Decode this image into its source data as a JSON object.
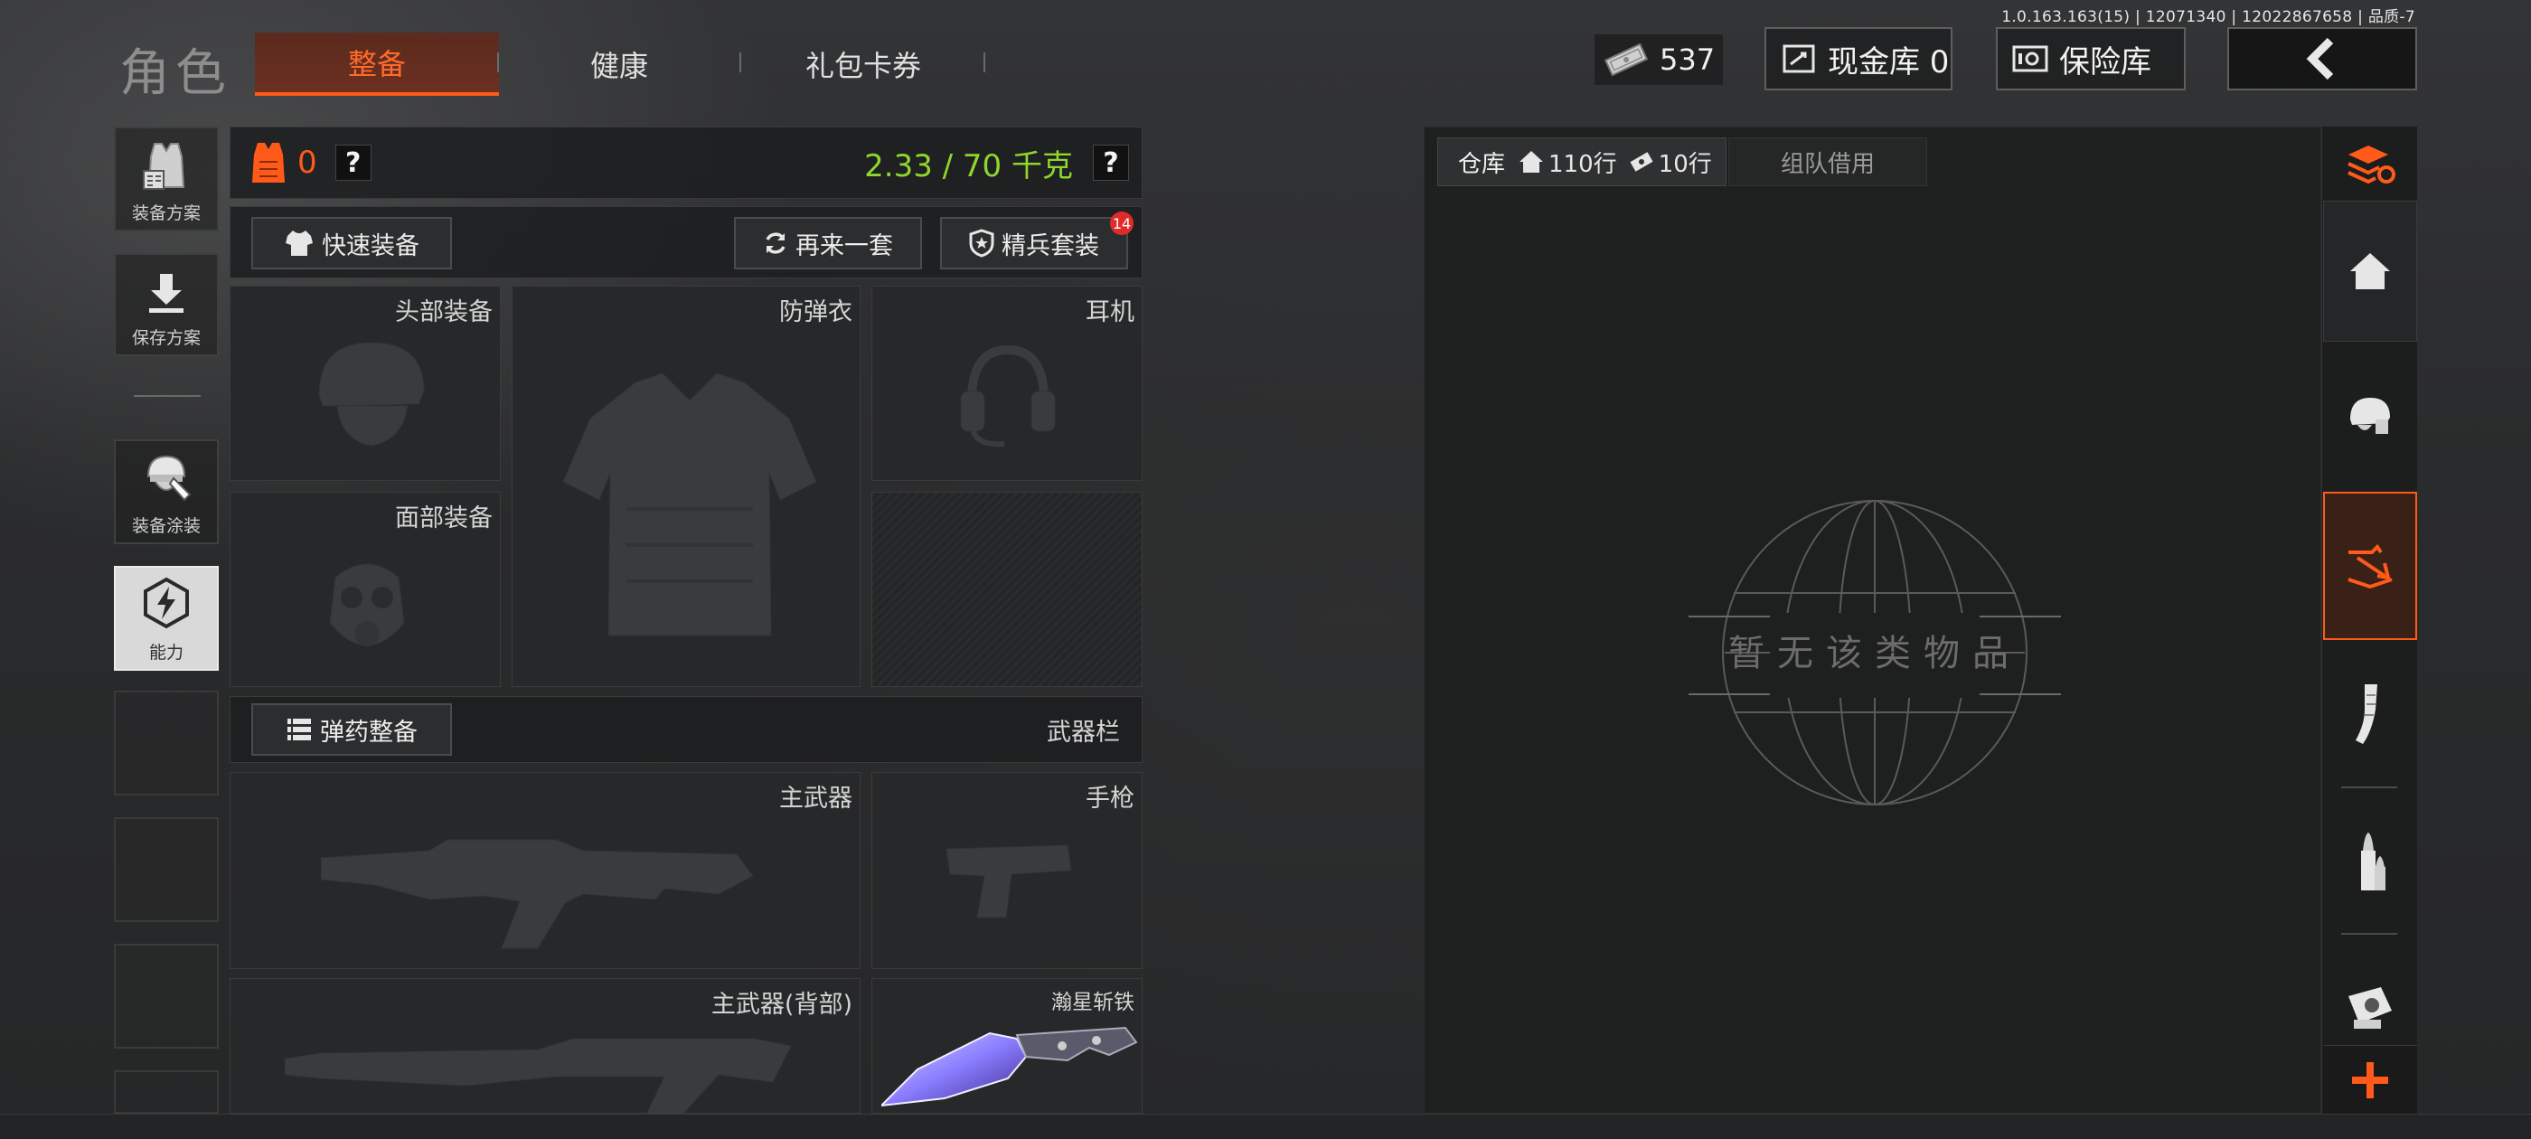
{
  "version": "1.0.163.163(15) | 12071340 | 12022867658 | 品质-7",
  "nav": {
    "title": "角色",
    "tabs": [
      {
        "label": "整备",
        "active": true
      },
      {
        "label": "健康",
        "active": false
      },
      {
        "label": "礼包卡券",
        "active": false
      }
    ]
  },
  "currency": {
    "amount": "537"
  },
  "topbar": {
    "cash_vault_label": "现金库 0",
    "safe_label": "保险库"
  },
  "side_menu": [
    {
      "label": "装备方案",
      "icon": "vest-plan-icon"
    },
    {
      "label": "保存方案",
      "icon": "download-save-icon"
    },
    {
      "label": "装备涂装",
      "icon": "helmet-paint-icon"
    },
    {
      "label": "能力",
      "icon": "lightning-hex-icon"
    }
  ],
  "loadout": {
    "armor_count": "0",
    "help": "?",
    "weight": "2.33 / 70 千克",
    "quick_equip": "快速装备",
    "reroll": "再来一套",
    "elite_kit": "精兵套装",
    "elite_badge": "14",
    "slots": {
      "head": "头部装备",
      "vest": "防弹衣",
      "headset": "耳机",
      "face": "面部装备"
    },
    "ammo_btn": "弹药整备",
    "weapon_bar": "武器栏",
    "weapons": {
      "primary": "主武器",
      "pistol": "手枪",
      "primary_back": "主武器(背部)",
      "melee": "瀚星斩铁"
    }
  },
  "warehouse": {
    "tab_label": "仓库",
    "rows_home": "110行",
    "rows_ticket": "10行",
    "team_tab": "组队借用",
    "empty_text": "暂无该类物品"
  },
  "colors": {
    "accent": "#ff5a1a",
    "weight_green": "#8fd62e",
    "badge_red": "#e02b2b"
  }
}
